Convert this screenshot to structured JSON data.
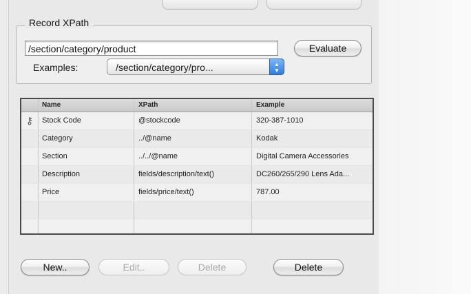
{
  "record_xpath": {
    "legend": "Record XPath",
    "xpath_value": "/section/category/product",
    "evaluate_label": "Evaluate",
    "examples_label": "Examples:",
    "examples_selected": "/section/category/pro..."
  },
  "table": {
    "columns": [
      "Name",
      "XPath",
      "Example"
    ],
    "rows": [
      {
        "key": true,
        "name": "Stock Code",
        "xpath": "@stockcode",
        "example": "320-387-1010"
      },
      {
        "key": false,
        "name": "Category",
        "xpath": "../@name",
        "example": "Kodak"
      },
      {
        "key": false,
        "name": "Section",
        "xpath": "../../@name",
        "example": "Digital Camera Accessories"
      },
      {
        "key": false,
        "name": "Description",
        "xpath": "fields/description/text()",
        "example": "DC260/265/290 Lens Ada..."
      },
      {
        "key": false,
        "name": "Price",
        "xpath": "fields/price/text()",
        "example": "787.00"
      }
    ]
  },
  "buttons": {
    "new": "New..",
    "edit": "Edit..",
    "delete_disabled": "Delete",
    "delete": "Delete"
  },
  "icons": {
    "key_icon": "key-icon",
    "popup_arrows": "updown-arrows-icon"
  }
}
